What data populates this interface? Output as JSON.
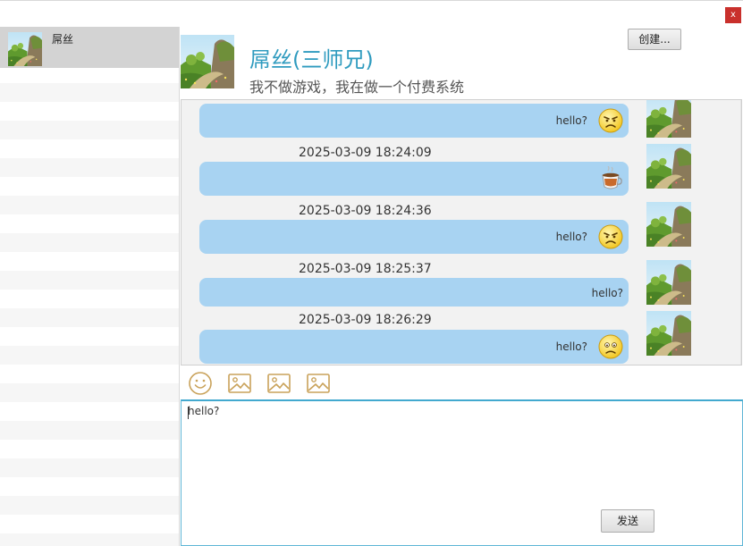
{
  "window": {
    "close_label": "x"
  },
  "sidebar": {
    "contacts": [
      {
        "name": "屌丝",
        "avatar": "landscape-avatar",
        "selected": true
      }
    ]
  },
  "header": {
    "title": "屌丝(三师兄)",
    "subtitle": "我不做游戏，我在做一个付费系统",
    "create_label": "创建..."
  },
  "messages": [
    {
      "timestamp": "",
      "text": "hello?",
      "emoji": "angry-face-icon"
    },
    {
      "timestamp": "2025-03-09 18:24:09",
      "text": "",
      "emoji": "coffee-cup-icon"
    },
    {
      "timestamp": "2025-03-09 18:24:36",
      "text": "hello?",
      "emoji": "angry-face-icon"
    },
    {
      "timestamp": "2025-03-09 18:25:37",
      "text": "hello?",
      "emoji": ""
    },
    {
      "timestamp": "2025-03-09 18:26:29",
      "text": "hello?",
      "emoji": "sad-face-icon"
    }
  ],
  "toolbar": {
    "items": [
      "emoji-icon",
      "image-icon",
      "image-icon",
      "image-icon"
    ]
  },
  "input": {
    "value": "hello?",
    "send_label": "发送"
  },
  "colors": {
    "accent": "#2f9bbf",
    "bubble": "#a8d3f2",
    "chat_bg": "#f2f2f2",
    "selected_contact": "#d3d3d3",
    "close": "#c9302c"
  }
}
